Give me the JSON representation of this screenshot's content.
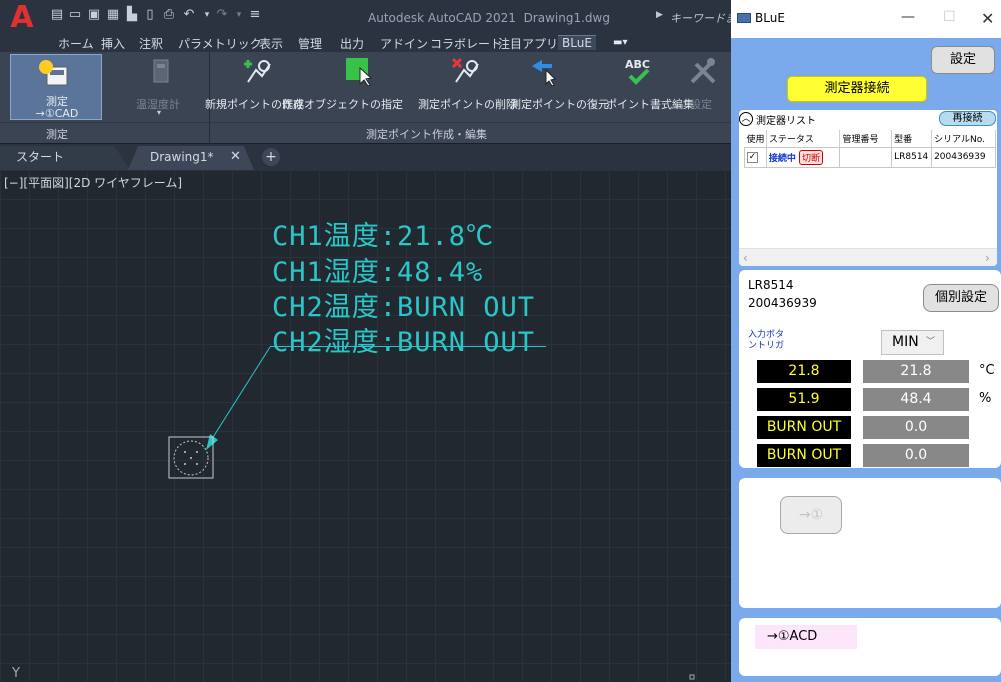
{
  "acad": {
    "app_title": "Autodesk AutoCAD 2021",
    "doc_title": "Drawing1.dwg",
    "search_placeholder": "キーワードまた",
    "menu": [
      "ホーム",
      "挿入",
      "注釈",
      "パラメトリック",
      "表示",
      "管理",
      "出力",
      "アドイン",
      "コラボレート",
      "注目アプリ",
      "BLuE"
    ],
    "ribbon": {
      "measure_label_1": "測定",
      "measure_label_2": "→①CAD",
      "thermo_label": "温湿度計",
      "new_point": "新規ポイントの作成",
      "existing_obj": "既存オブジェクトの指定",
      "delete_point": "測定ポイントの削除",
      "restore_point": "測定ポイントの復元",
      "point_format": "ポイント書式編集",
      "settings": "設定",
      "panel_measure": "測定",
      "panel_edit": "測定ポイント作成・編集"
    },
    "tabs": {
      "start": "スタート",
      "drawing": "Drawing1*",
      "close": "✕",
      "new": "+"
    },
    "viewport_label": "[−][平面図][2D ワイヤフレーム]",
    "cad_lines": [
      "CH1温度:21.8℃",
      "CH1湿度:48.4%",
      "CH2温度:BURN OUT",
      "CH2湿度:BURN OUT"
    ],
    "ucs_label": "Y",
    "colors": {
      "accent": "#2bc6c8",
      "logo": "#e03030"
    }
  },
  "blue": {
    "title": "BLuE",
    "btn_settings": "設定",
    "btn_connect": "測定器接続",
    "device_list": {
      "title": "測定器リスト",
      "reconnect": "再接続",
      "columns": [
        "使用",
        "ステータス",
        "管理番号",
        "型番",
        "シリアルNo."
      ],
      "rows": [
        {
          "use": "✓",
          "status": "接続中",
          "disconnect": "切断",
          "id": "",
          "model": "LR8514",
          "serial": "200436939"
        }
      ]
    },
    "detail": {
      "model": "LR8514",
      "serial": "200436939",
      "btn_individual": "個別設定",
      "trigger_label": "入力ボタントリガ",
      "trigger_mode": "MIN",
      "readings": [
        {
          "realtime": "21.8",
          "stored": "21.8",
          "unit": "°C",
          "color": "#ffff33"
        },
        {
          "realtime": "51.9",
          "stored": "48.4",
          "unit": "%",
          "color": "#ffff33"
        },
        {
          "realtime": "BURN OUT",
          "stored": "0.0",
          "unit": "",
          "color": "#ffff33"
        },
        {
          "realtime": "BURN OUT",
          "stored": "0.0",
          "unit": "",
          "color": "#ffff33"
        }
      ]
    },
    "btn_send": "→①",
    "target": "→①ACD"
  }
}
